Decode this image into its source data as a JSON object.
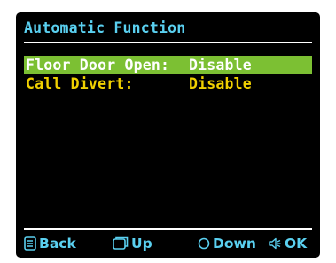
{
  "screen": {
    "title": "Automatic Function"
  },
  "menu": {
    "items": [
      {
        "label": "Floor Door Open:",
        "value": "Disable",
        "selected": true
      },
      {
        "label": "Call Divert:",
        "value": "Disable",
        "selected": false
      }
    ]
  },
  "softkeys": {
    "back": {
      "label": "Back",
      "icon": "list-icon"
    },
    "up": {
      "label": "Up",
      "icon": "window-icon"
    },
    "down": {
      "label": "Down",
      "icon": "circle-icon"
    },
    "ok": {
      "label": "OK",
      "icon": "speaker-icon"
    }
  },
  "colors": {
    "background": "#000000",
    "title": "#5ad0f0",
    "item_text": "#f0d000",
    "selected_bg": "#7cc033",
    "selected_text": "#ffffff",
    "softkey_text": "#5ad0f0"
  }
}
